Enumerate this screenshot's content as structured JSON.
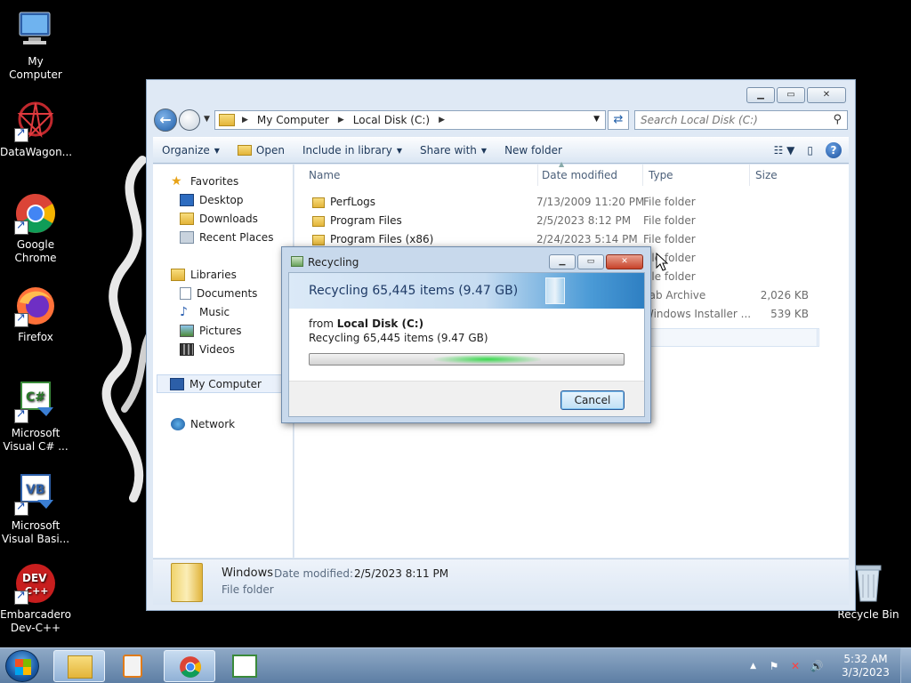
{
  "desktop": {
    "icons": [
      {
        "label": "My Computer"
      },
      {
        "label": "DataWagon..."
      },
      {
        "label": "Google Chrome"
      },
      {
        "label": "Firefox"
      },
      {
        "label": "Microsoft Visual C# ..."
      },
      {
        "label": "Microsoft Visual Basi..."
      },
      {
        "label": "Embarcadero Dev-C++"
      },
      {
        "label": "Recycle Bin"
      }
    ]
  },
  "explorer": {
    "breadcrumb": [
      "My Computer",
      "Local Disk (C:)"
    ],
    "search_placeholder": "Search Local Disk (C:)",
    "toolbar": {
      "organize": "Organize",
      "open": "Open",
      "include_in_library": "Include in library",
      "share_with": "Share with",
      "new_folder": "New folder"
    },
    "nav": {
      "favorites": "Favorites",
      "desktop": "Desktop",
      "downloads": "Downloads",
      "recent_places": "Recent Places",
      "libraries": "Libraries",
      "documents": "Documents",
      "music": "Music",
      "pictures": "Pictures",
      "videos": "Videos",
      "my_computer": "My Computer",
      "network": "Network"
    },
    "columns": {
      "name": "Name",
      "date": "Date modified",
      "type": "Type",
      "size": "Size"
    },
    "rows": [
      {
        "name": "PerfLogs",
        "date": "7/13/2009 11:20 PM",
        "type": "File folder",
        "size": ""
      },
      {
        "name": "Program Files",
        "date": "2/5/2023 8:12 PM",
        "type": "File folder",
        "size": ""
      },
      {
        "name": "Program Files (x86)",
        "date": "2/24/2023 5:14 PM",
        "type": "File folder",
        "size": ""
      },
      {
        "name": "",
        "date": "",
        "type": "File folder",
        "size": ""
      },
      {
        "name": "",
        "date": "",
        "type": "File folder",
        "size": ""
      },
      {
        "name": "",
        "date": "",
        "type": "cab Archive",
        "size": "2,026 KB"
      },
      {
        "name": "",
        "date": "",
        "type": "Windows Installer ...",
        "size": "539 KB"
      }
    ],
    "details": {
      "name": "Windows",
      "date_label": "Date modified:",
      "date_value": "2/5/2023 8:11 PM",
      "type": "File folder"
    }
  },
  "dialog": {
    "title": "Recycling",
    "header": "Recycling 65,445 items (9.47 GB)",
    "from_prefix": "from ",
    "from_location": "Local Disk (C:)",
    "status": "Recycling 65,445 items (9.47 GB)",
    "cancel": "Cancel"
  },
  "taskbar": {
    "time": "5:32 AM",
    "date": "3/3/2023"
  },
  "colors": {
    "explorer_chrome": "#dfe9f5",
    "dialog_header_accent": "#2e7fc2",
    "progress_glow": "#38d84c",
    "taskbar": "#5d7ea4"
  }
}
